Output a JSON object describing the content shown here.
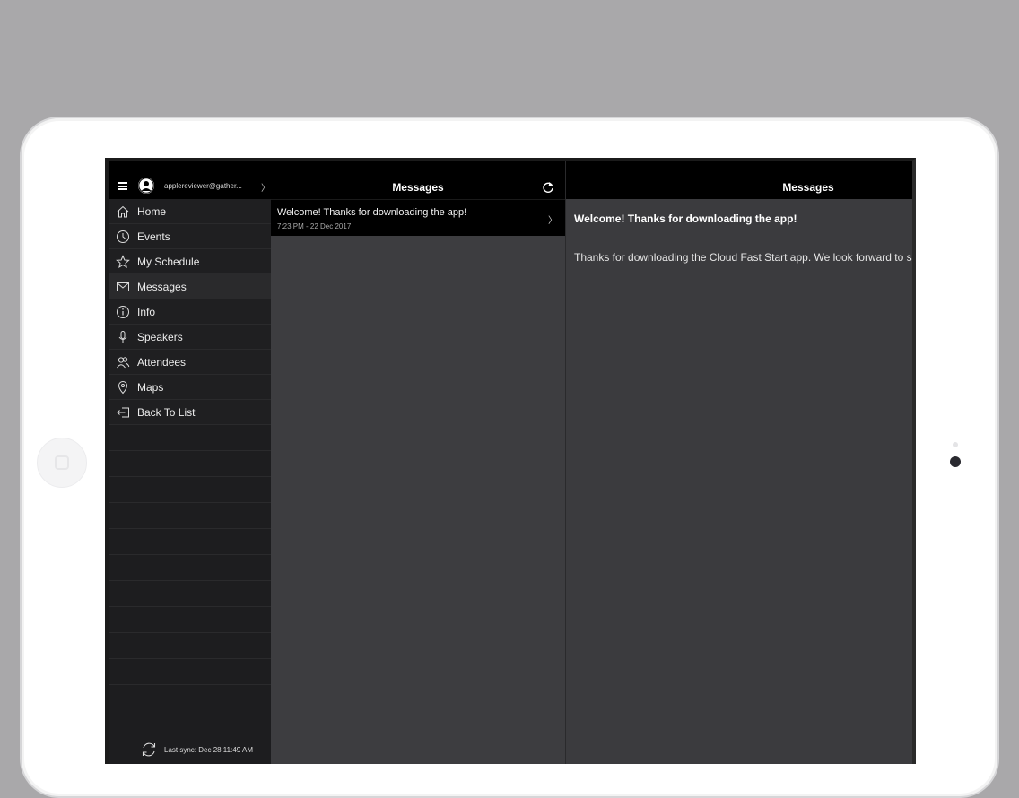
{
  "sidebar": {
    "account_email": "applereviewer@gather...",
    "items": [
      {
        "label": "Home",
        "icon": "home-icon"
      },
      {
        "label": "Events",
        "icon": "clock-icon"
      },
      {
        "label": "My Schedule",
        "icon": "star-icon"
      },
      {
        "label": "Messages",
        "icon": "envelope-icon"
      },
      {
        "label": "Info",
        "icon": "info-icon"
      },
      {
        "label": "Speakers",
        "icon": "microphone-icon"
      },
      {
        "label": "Attendees",
        "icon": "people-icon"
      },
      {
        "label": "Maps",
        "icon": "map-pin-icon"
      },
      {
        "label": "Back To List",
        "icon": "back-arrow-icon"
      }
    ],
    "active_item": "Messages",
    "sync_text": "Last sync:   Dec 28 11:49 AM"
  },
  "list": {
    "title": "Messages",
    "messages": [
      {
        "title": "Welcome! Thanks for downloading the app!",
        "time": "7:23 PM - 22 Dec 2017"
      }
    ]
  },
  "detail": {
    "title": "Messages",
    "message_title": "Welcome! Thanks for downloading the app!",
    "message_body": "Thanks for downloading the Cloud Fast Start app. We look forward to se"
  }
}
